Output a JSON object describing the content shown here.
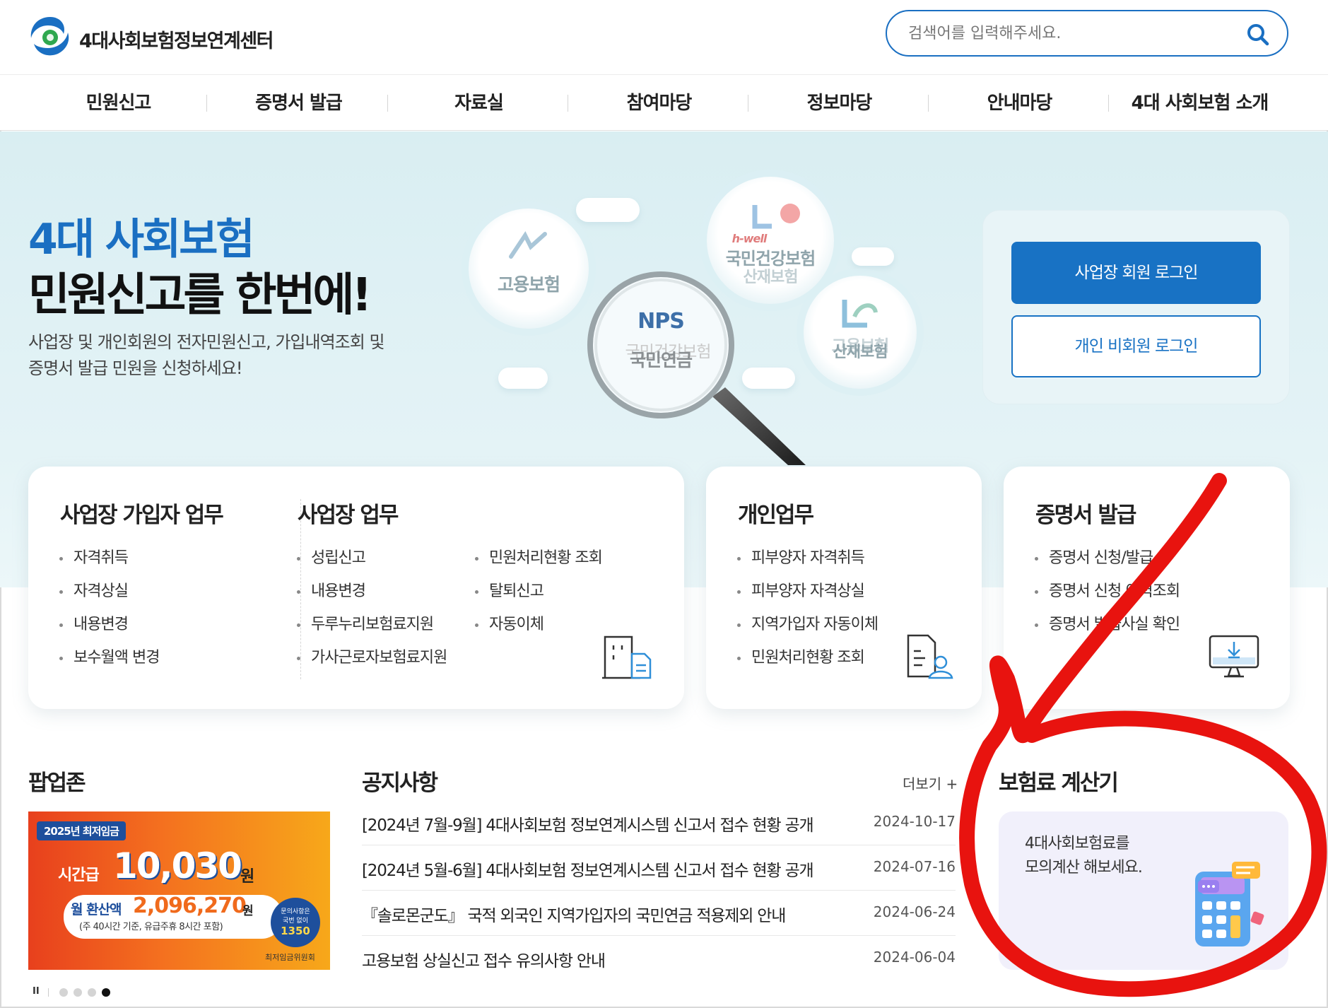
{
  "header": {
    "site_title": "4대사회보험정보연계센터",
    "search_placeholder": "검색어를 입력해주세요."
  },
  "gnb": {
    "items": [
      {
        "label": "민원신고"
      },
      {
        "label": "증명서 발급"
      },
      {
        "label": "자료실"
      },
      {
        "label": "참여마당"
      },
      {
        "label": "정보마당"
      },
      {
        "label": "안내마당"
      },
      {
        "label": "4대 사회보험 소개"
      }
    ]
  },
  "hero": {
    "title_line1": "4대 사회보험",
    "title_line2": "민원신고를 한번에!",
    "desc_line1": "사업장 및 개인회원의 전자민원신고, 가입내역조회 및",
    "desc_line2": "증명서 발급 민원을 신청하세요!",
    "bubbles": {
      "employment": "고용보험",
      "health_brand": "h-well",
      "health": "국민건강보험",
      "health_under": "산재보험",
      "nps": "NPS",
      "pension": "국민연금",
      "pension_under": "국민건강보험",
      "industrial": "산재보험",
      "industrial_under": "고용보험"
    }
  },
  "login": {
    "business_label": "사업장 회원 로그인",
    "personal_label": "개인 비회원 로그인"
  },
  "cards": {
    "biz_member": {
      "title": "사업장 가입자 업무",
      "items": [
        "자격취득",
        "자격상실",
        "내용변경",
        "보수월액 변경"
      ]
    },
    "biz": {
      "title": "사업장 업무",
      "col1": [
        "성립신고",
        "내용변경",
        "두루누리보험료지원",
        "가사근로자보험료지원"
      ],
      "col2": [
        "민원처리현황 조회",
        "탈퇴신고",
        "자동이체"
      ]
    },
    "personal": {
      "title": "개인업무",
      "items": [
        "피부양자 자격취득",
        "피부양자 자격상실",
        "지역가입자 자동이체",
        "민원처리현황 조회"
      ]
    },
    "certificate": {
      "title": "증명서 발급",
      "items": [
        "증명서 신청/발급",
        "증명서 신청 이력조회",
        "증명서 발급사실 확인"
      ]
    }
  },
  "popup": {
    "title": "팝업존",
    "banner": {
      "badge": "2025년 최저임금",
      "hourly_label": "시간급",
      "hourly_value": "10,030",
      "unit": "원",
      "monthly_label": "월 환산액",
      "monthly_value": "2,096,270",
      "monthly_note": "(주 40시간 기준, 유급주휴 8시간 포함)",
      "contact_line1": "문의사항은",
      "contact_line2": "국번 없이",
      "contact_number": "1350",
      "org": "최저임금위원회"
    },
    "pause_label": "II",
    "slides": 4,
    "active_slide": 4
  },
  "notice": {
    "title": "공지사항",
    "more_label": "더보기 +",
    "items": [
      {
        "title": "[2024년 7월-9월] 4대사회보험 정보연계시스템 신고서 접수 현황 공개",
        "date": "2024-10-17"
      },
      {
        "title": "[2024년 5월-6월] 4대사회보험 정보연계시스템 신고서 접수 현황 공개",
        "date": "2024-07-16"
      },
      {
        "title": "『솔로몬군도』 국적 외국인 지역가입자의 국민연금 적용제외 안내",
        "date": "2024-06-24"
      },
      {
        "title": "고용보험 상실신고 접수 유의사항 안내",
        "date": "2024-06-04"
      }
    ]
  },
  "calculator": {
    "title": "보험료 계산기",
    "desc_line1": "4대사회보험료를",
    "desc_line2": "모의계산 해보세요."
  },
  "colors": {
    "brand_blue": "#1872c4",
    "hero_bg": "#d9eef2",
    "annotation_red": "#e8130f"
  }
}
